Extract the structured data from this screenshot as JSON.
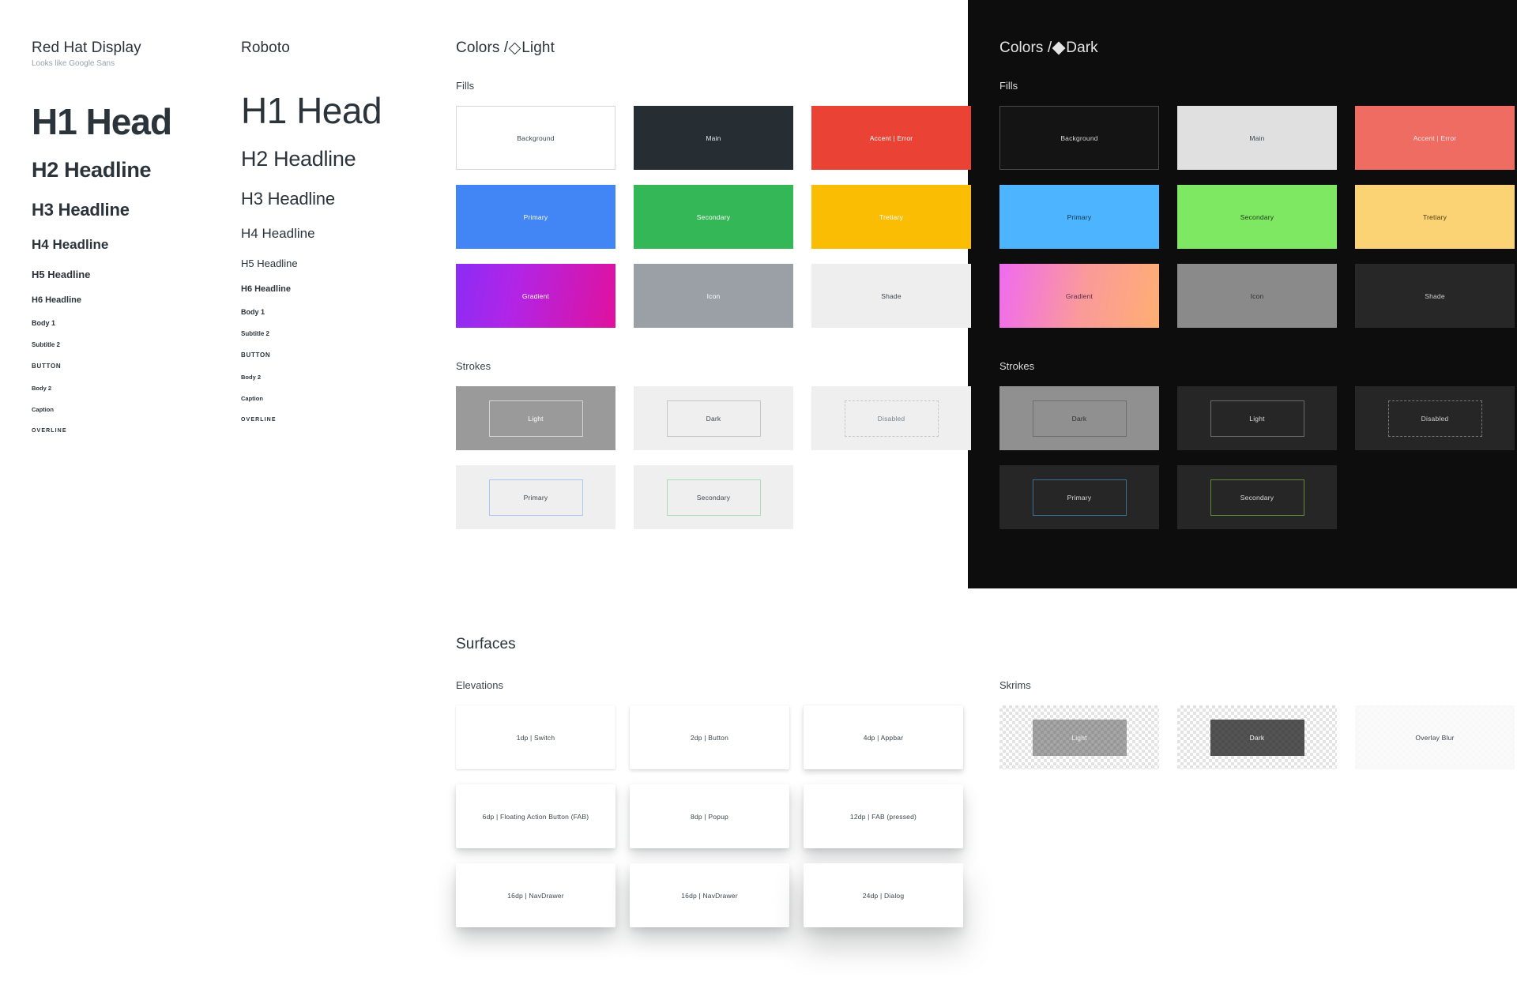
{
  "typography": {
    "columns": [
      {
        "name": "Red Hat Display",
        "note": "Looks like Google Sans",
        "samples": [
          "H1 Head",
          "H2 Headline",
          "H3 Headline",
          "H4 Headline",
          "H5 Headline",
          "H6 Headline",
          "Body 1",
          "Subtitle 2",
          "BUTTON",
          "Body 2",
          "Caption",
          "OVERLINE"
        ]
      },
      {
        "name": "Roboto",
        "note": "",
        "samples": [
          "H1 Head",
          "H2 Headline",
          "H3 Headline",
          "H4 Headline",
          "H5 Headline",
          "H6 Headline",
          "Body 1",
          "Subtitle 2",
          "BUTTON",
          "Body 2",
          "Caption",
          "OVERLINE"
        ]
      }
    ]
  },
  "colors_light": {
    "title_prefix": "Colors /",
    "title_theme": "Light",
    "theme_icon": "diamond-outline-icon",
    "fills_label": "Fills",
    "strokes_label": "Strokes",
    "fills": [
      {
        "label": "Background",
        "hex": "#FFFFFF"
      },
      {
        "label": "Main",
        "hex": "#262D33"
      },
      {
        "label": "Accent | Error",
        "hex": "#EA4335"
      },
      {
        "label": "Primary",
        "hex": "#4285F4"
      },
      {
        "label": "Secondary",
        "hex": "#34B757"
      },
      {
        "label": "Tretiary",
        "hex": "#FBBC04"
      },
      {
        "label": "Gradient",
        "hex": "#8B2CF5"
      },
      {
        "label": "Icon",
        "hex": "#9AA0A6"
      },
      {
        "label": "Shade",
        "hex": "#EEEEEE"
      }
    ],
    "strokes": [
      {
        "label": "Light",
        "hex": "#D5D5D5"
      },
      {
        "label": "Dark",
        "hex": "#C5C5C5"
      },
      {
        "label": "Disabled",
        "hex": "#C8C8C8"
      },
      {
        "label": "Primary",
        "hex": "#A9C6F5"
      },
      {
        "label": "Secondary",
        "hex": "#A9DDB8"
      }
    ]
  },
  "colors_dark": {
    "title_prefix": "Colors /",
    "title_theme": "Dark",
    "theme_icon": "diamond-filled-icon",
    "fills_label": "Fills",
    "strokes_label": "Strokes",
    "fills": [
      {
        "label": "Background",
        "hex": "#141414"
      },
      {
        "label": "Main",
        "hex": "#E0E0E0"
      },
      {
        "label": "Accent | Error",
        "hex": "#EF6C63"
      },
      {
        "label": "Primary",
        "hex": "#4DB5FF"
      },
      {
        "label": "Secondary",
        "hex": "#7EE863"
      },
      {
        "label": "Tretiary",
        "hex": "#FBD375"
      },
      {
        "label": "Gradient",
        "hex": "#F06AF0"
      },
      {
        "label": "Icon",
        "hex": "#8A8A8A"
      },
      {
        "label": "Shade",
        "hex": "#272727"
      }
    ],
    "strokes": [
      {
        "label": "Dark",
        "hex": "#6E6E6E"
      },
      {
        "label": "Light",
        "hex": "#6A6A6A"
      },
      {
        "label": "Disabled",
        "hex": "#787878"
      },
      {
        "label": "Primary",
        "hex": "#3D6F94"
      },
      {
        "label": "Secondary",
        "hex": "#5F8A3F"
      }
    ]
  },
  "surfaces": {
    "title": "Surfaces",
    "elevations_label": "Elevations",
    "skrims_label": "Skrims",
    "elevations": [
      {
        "label": "1dp | Switch"
      },
      {
        "label": "2dp | Button"
      },
      {
        "label": "4dp | Appbar"
      },
      {
        "label": "6dp | Floating Action Button (FAB)"
      },
      {
        "label": "8dp | Popup"
      },
      {
        "label": "12dp | FAB (pressed)"
      },
      {
        "label": "16dp | NavDrawer"
      },
      {
        "label": "16dp | NavDrawer"
      },
      {
        "label": "24dp | Dialog"
      }
    ],
    "skrims": [
      {
        "label": "Light"
      },
      {
        "label": "Dark"
      },
      {
        "label": "Overlay Blur"
      }
    ]
  }
}
